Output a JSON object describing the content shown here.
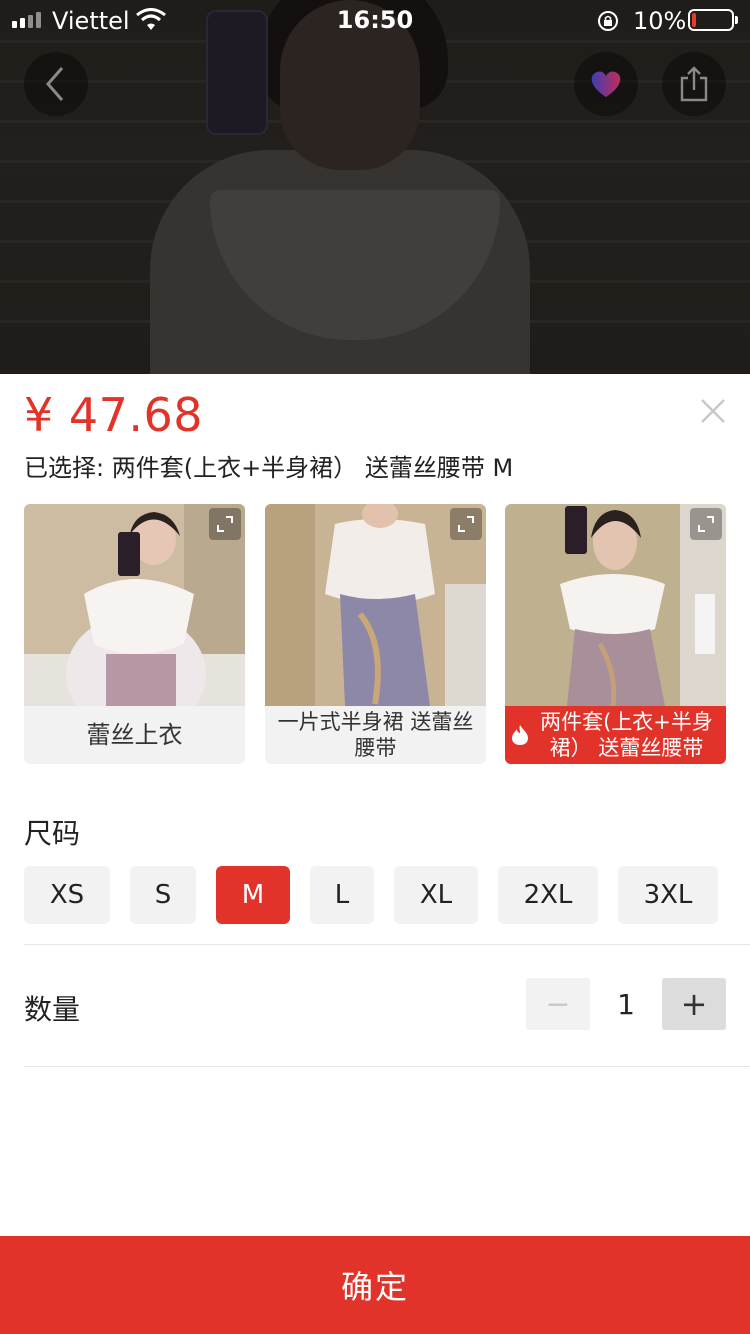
{
  "status_bar": {
    "carrier": "Viettel",
    "time": "16:50",
    "battery_percent": "10%"
  },
  "header_icons": {
    "back": "back-icon",
    "favorite": "heart-icon",
    "share": "share-icon"
  },
  "sheet": {
    "price": "¥ 47.68",
    "selected_text": "已选择: 两件套(上衣+半身裙） 送蕾丝腰带 M",
    "variants": [
      {
        "label": "蕾丝上衣",
        "selected": false
      },
      {
        "label": "一片式半身裙 送蕾丝腰带",
        "selected": false
      },
      {
        "label": "两件套(上衣+半身裙） 送蕾丝腰带",
        "selected": true
      }
    ],
    "size_title": "尺码",
    "sizes": [
      "XS",
      "S",
      "M",
      "L",
      "XL",
      "2XL",
      "3XL"
    ],
    "selected_size": "M",
    "quantity_title": "数量",
    "quantity": "1",
    "minus_label": "−",
    "plus_label": "+",
    "confirm_label": "确定"
  },
  "colors": {
    "accent": "#e2332a",
    "chip_bg": "#f2f2f2"
  }
}
